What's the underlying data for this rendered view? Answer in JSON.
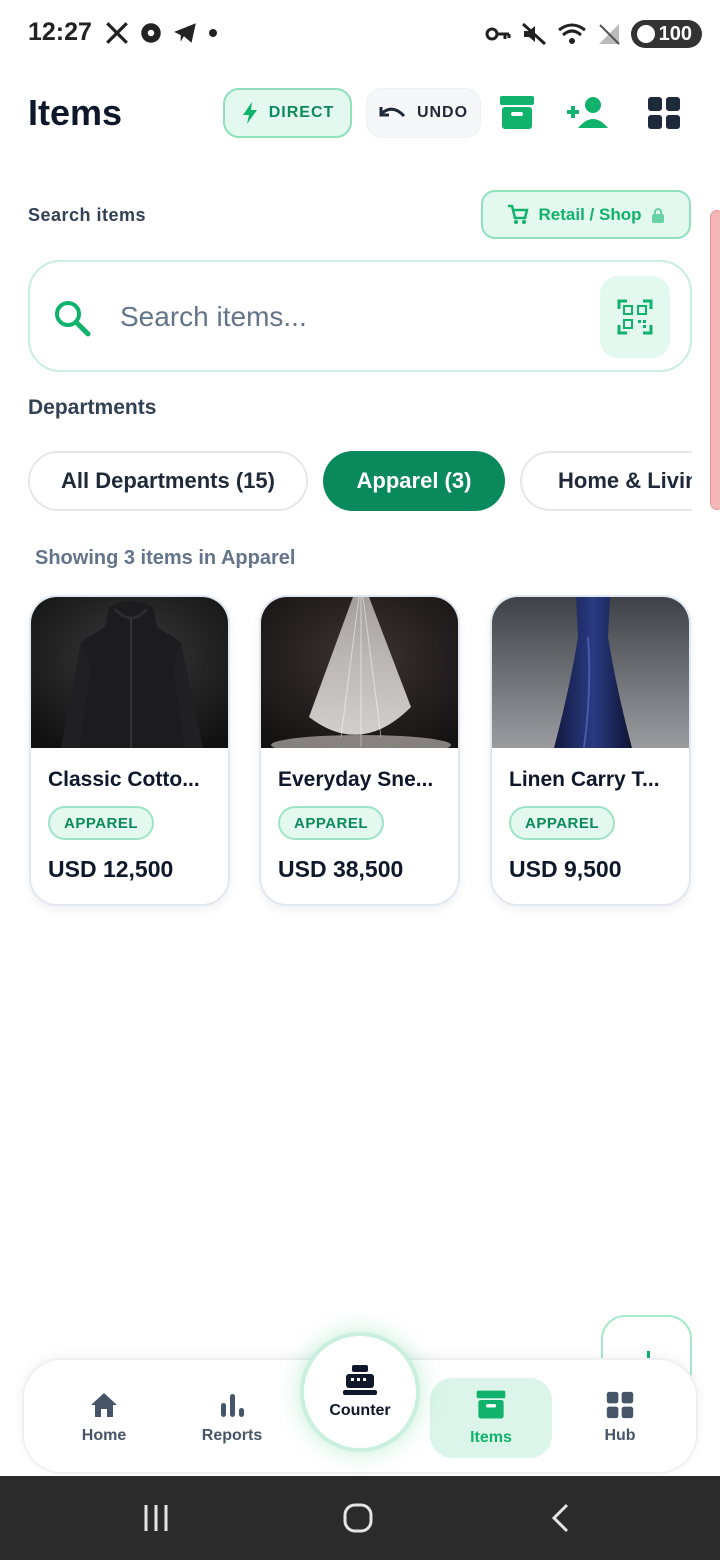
{
  "status_bar": {
    "time": "12:27",
    "battery": "100"
  },
  "header": {
    "title": "Items",
    "direct_label": "DIRECT",
    "undo_label": "UNDO"
  },
  "search": {
    "label": "Search items",
    "shop_label": "Retail / Shop",
    "placeholder": "Search items..."
  },
  "departments": {
    "label": "Departments",
    "chips": [
      "All Departments (15)",
      "Apparel (3)",
      "Home & Living"
    ]
  },
  "showing_text": "Showing 3 items in Apparel",
  "items": [
    {
      "name": "Classic Cotto...",
      "category": "APPAREL",
      "price": "USD 12,500"
    },
    {
      "name": "Everyday Sne...",
      "category": "APPAREL",
      "price": "USD 38,500"
    },
    {
      "name": "Linen Carry T...",
      "category": "APPAREL",
      "price": "USD 9,500"
    }
  ],
  "bottom_nav": {
    "home": "Home",
    "reports": "Reports",
    "counter": "Counter",
    "items": "Items",
    "hub": "Hub"
  },
  "colors": {
    "accent": "#10b26c",
    "accent_dark": "#0a8a5c",
    "accent_light": "#e3f8ef"
  }
}
